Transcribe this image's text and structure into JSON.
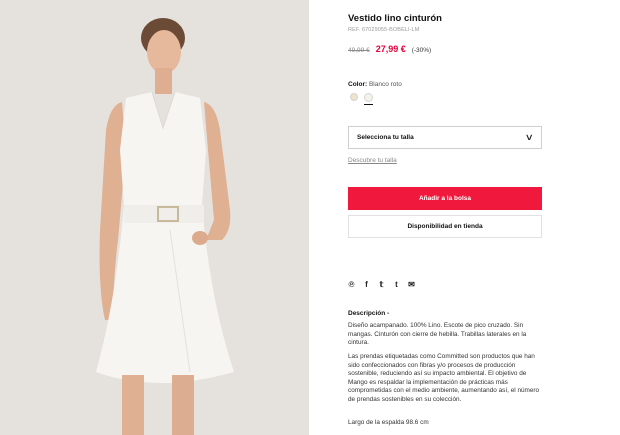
{
  "product": {
    "title": "Vestido lino cinturón",
    "ref": "REF. 67029055-BOBELI-LM",
    "old_price": "49,99 €",
    "price": "27,99 €",
    "discount": "(-30%)",
    "color_label": "Color:",
    "color_value": "Blanco roto",
    "swatches": [
      "#efe3c9",
      "#f4f2ea"
    ],
    "size_select": "Selecciona tu talla",
    "size_guide": "Descubre tu talla",
    "add_to_bag": "Añadir a la bolsa",
    "store_availability": "Disponibilidad en tienda",
    "share_icons": [
      "pinterest-icon",
      "facebook-icon",
      "twitter-icon",
      "tumblr-icon",
      "email-icon"
    ],
    "description_title": "Descripción -",
    "description": [
      "Diseño acampanado. 100% Lino. Escote de pico cruzado. Sin mangas. Cinturón con cierre de hebilla. Trabillas laterales en la cintura.",
      "Las prendas etiquetadas como Committed son productos que han sido confeccionados con fibras y/o procesos de producción sostenible, reduciendo así su impacto ambiental. El objetivo de Mango es respaldar la implementación de prácticas más comprometidas con el medio ambiente, aumentando así, el número de prendas sostenibles en su colección.",
      "Largo de la espalda 98.6 cm"
    ]
  },
  "colors": {
    "accent": "#f0193d",
    "sale": "#e6003a",
    "photo_bg": "#e5e2dd"
  }
}
